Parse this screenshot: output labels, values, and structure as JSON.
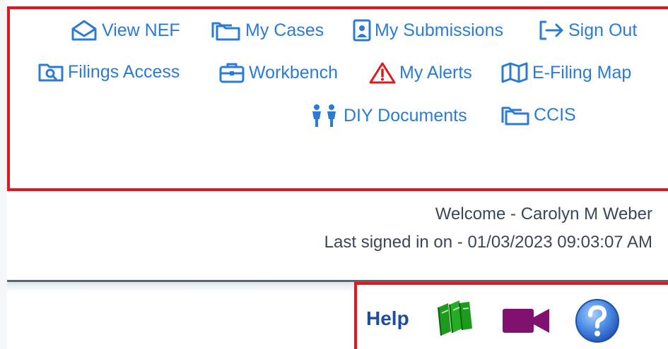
{
  "nav": {
    "view_nef": "View NEF",
    "my_cases": "My Cases",
    "my_submissions": "My Submissions",
    "sign_out": "Sign Out",
    "filings_access": "Filings Access",
    "workbench": "Workbench",
    "my_alerts": "My Alerts",
    "efiling_map": "E-Filing Map",
    "diy_documents": "DIY Documents",
    "ccis": "CCIS"
  },
  "user": {
    "welcome": "Welcome - Carolyn M Weber",
    "last_signed": "Last signed in on - 01/03/2023 09:03:07 AM"
  },
  "help": {
    "label": "Help"
  },
  "icons": {
    "view_nef": "envelope-open-icon",
    "my_cases": "folder-stack-icon",
    "my_submissions": "person-document-icon",
    "sign_out": "sign-out-arrow-icon",
    "filings_access": "folder-search-icon",
    "workbench": "briefcase-icon",
    "my_alerts": "warning-triangle-icon",
    "efiling_map": "map-icon",
    "diy_documents": "people-icon",
    "ccis": "folder-icon",
    "help_manual": "green-books-icon",
    "help_video": "video-camera-icon",
    "help_question": "question-mark-icon"
  },
  "colors": {
    "link": "#2b7bd6",
    "alert": "#e01818",
    "highlight_border": "#e6141c",
    "help_label": "#1f4c9a",
    "books": "#1e9a1e",
    "video": "#80116e",
    "question": "#3b7fe0"
  }
}
